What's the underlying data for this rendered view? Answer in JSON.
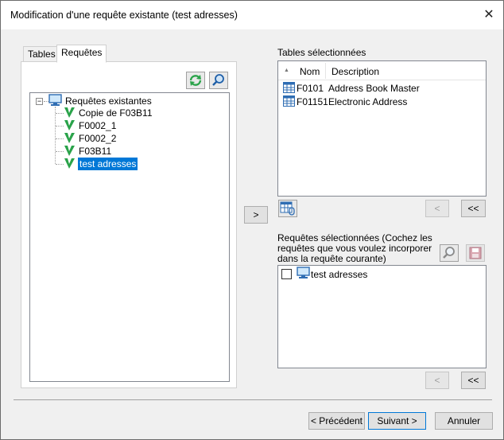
{
  "window": {
    "title": "Modification d'une requête existante (test adresses)",
    "close_glyph": "✕"
  },
  "tabs": [
    {
      "label": "Tables"
    },
    {
      "label": "Requêtes"
    }
  ],
  "tree": {
    "root_label": "Requêtes existantes",
    "items": [
      {
        "label": "Copie de F03B11"
      },
      {
        "label": "F0002_1"
      },
      {
        "label": "F0002_2"
      },
      {
        "label": "F03B11"
      },
      {
        "label": "test adresses",
        "selected": true
      }
    ]
  },
  "add_button": {
    "label": ">"
  },
  "selected_tables": {
    "heading": "Tables sélectionnées",
    "columns": [
      "Nom",
      "Description"
    ],
    "sort_glyph": "▲",
    "rows": [
      {
        "name": "F0101",
        "description": "Address Book Master"
      },
      {
        "name": "F01151",
        "description": "Electronic Address"
      }
    ],
    "remove_label": "<",
    "remove_all_label": "<<"
  },
  "selected_queries": {
    "heading_line1": "Requêtes sélectionnées (Cochez les",
    "heading_line2": "requêtes que vous voulez incorporer",
    "heading_line3": "dans la requête courante)",
    "items": [
      {
        "label": "test adresses",
        "checked": false
      }
    ],
    "remove_label": "<",
    "remove_all_label": "<<"
  },
  "footer": {
    "previous": "< Précédent",
    "next": "Suivant >",
    "cancel": "Annuler"
  },
  "colors": {
    "selection": "#0078d7",
    "accent_green": "#2aa34a"
  }
}
